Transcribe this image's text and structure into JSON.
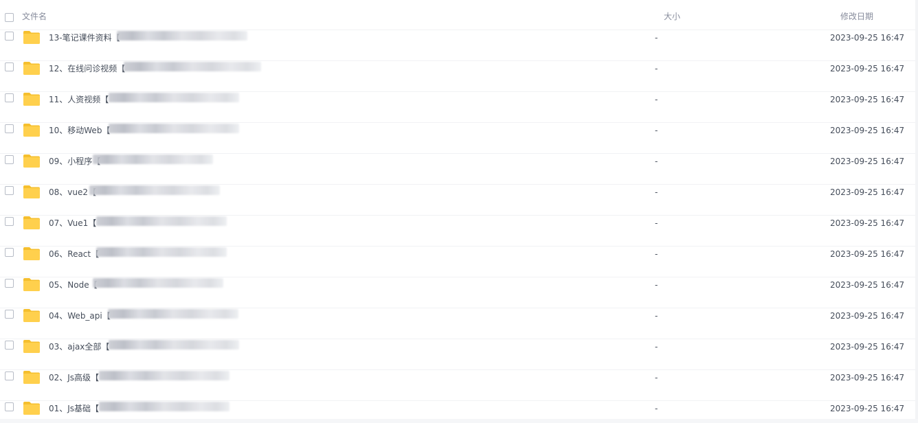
{
  "header": {
    "name_label": "文件名",
    "size_label": "大小",
    "date_label": "修改日期"
  },
  "colors": {
    "folder": "#ffd04d",
    "folder_tab": "#f5bf2e",
    "text": "#454d5a",
    "header_text": "#878c9c",
    "divider": "#f1f2f4"
  },
  "icons": {
    "folder": "folder-icon",
    "checkbox": "checkbox"
  },
  "rows": [
    {
      "name": "13-笔记课件资料【",
      "size": "-",
      "date": "2023-09-25 16:47"
    },
    {
      "name": "12、在线问诊视频【",
      "size": "-",
      "date": "2023-09-25 16:47"
    },
    {
      "name": "11、人资视频【",
      "size": "-",
      "date": "2023-09-25 16:47"
    },
    {
      "name": "10、移动Web【",
      "size": "-",
      "date": "2023-09-25 16:47"
    },
    {
      "name": "09、小程序【",
      "size": "-",
      "date": "2023-09-25 16:47"
    },
    {
      "name": "08、vue2【",
      "size": "-",
      "date": "2023-09-25 16:47"
    },
    {
      "name": "07、Vue1【",
      "size": "-",
      "date": "2023-09-25 16:47"
    },
    {
      "name": "06、React【",
      "size": "-",
      "date": "2023-09-25 16:47"
    },
    {
      "name": "05、Node【",
      "size": "-",
      "date": "2023-09-25 16:47"
    },
    {
      "name": "04、Web_api【",
      "size": "-",
      "date": "2023-09-25 16:47"
    },
    {
      "name": "03、ajax全部【",
      "size": "-",
      "date": "2023-09-25 16:47"
    },
    {
      "name": "02、Js高级【",
      "size": "-",
      "date": "2023-09-25 16:47"
    },
    {
      "name": "01、Js基础【",
      "size": "-",
      "date": "2023-09-25 16:47"
    }
  ]
}
